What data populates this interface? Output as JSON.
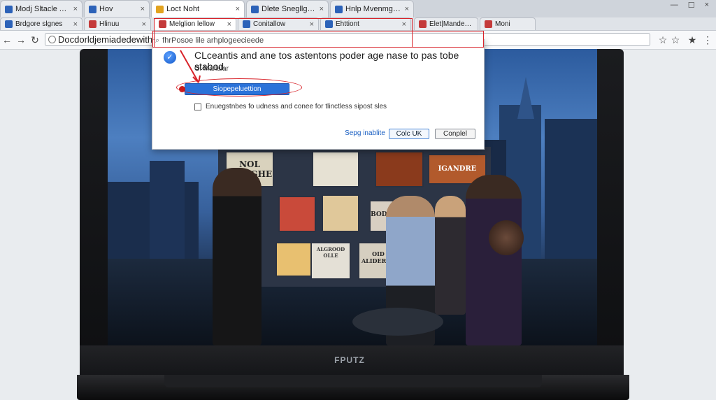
{
  "tabs_row1": [
    {
      "label": "Modj Sltacle Alteo",
      "fav": "#2c62b8",
      "active": false
    },
    {
      "label": "Hov",
      "fav": "#2c62b8",
      "active": false
    },
    {
      "label": "Loct Noht",
      "fav": "#e2a320",
      "active": true
    },
    {
      "label": "Dlete Snegllg Prdorts",
      "fav": "#2c62b8",
      "active": false
    },
    {
      "label": "Hnlp Mvenmglvvhit",
      "fav": "#2c62b8",
      "active": false
    }
  ],
  "tabs_row2": [
    {
      "label": "Brdgore slgnes",
      "fav": "#2c62b8",
      "active": false
    },
    {
      "label": "Hlinuu",
      "fav": "#c43a3a",
      "active": false
    },
    {
      "label": "Melglion lellow",
      "fav": "#c43a3a",
      "active": true
    },
    {
      "label": "Conitallow",
      "fav": "#2c62b8",
      "active": false
    },
    {
      "label": "Ehttiont",
      "fav": "#2c62b8",
      "active": false
    },
    {
      "label": "Elet|Mandencler",
      "fav": "#c43a3a",
      "active": false
    },
    {
      "label": "Moni",
      "fav": "#c43a3a",
      "active": false
    }
  ],
  "tab_close_glyph": "×",
  "window_controls": {
    "minimize": "—",
    "maximize": "☐",
    "close": "×"
  },
  "nav": {
    "url": "Docdorldjemiadedewith",
    "back_icon": "arrow-left-icon",
    "forward_icon": "arrow-right-icon",
    "reload_icon": "reload-icon",
    "search_hint": "fhrPosoe lile arhplogeecieede"
  },
  "dialog": {
    "message": "CLceantis and ane tos astentons poder age nase to pas tobe stabod.",
    "sub": "Oi Marlalar",
    "primary_button": "Siopepeluettion",
    "checkbox_label": "Enuegstnbes fo udness and conee for tlinctless sipost sles",
    "link": "Sepg inablite",
    "ok": "Colc UK",
    "cancel": "Conplel"
  },
  "screen": {
    "posters": [
      "NOL MANGHE",
      "ALGROOD OLLE",
      "OID ALIDERTO",
      "BODDIER",
      "IGANDRE"
    ],
    "brand": "FPUTZ"
  },
  "colors": {
    "accent": "#2a72d9",
    "annotation": "#d8232a"
  }
}
